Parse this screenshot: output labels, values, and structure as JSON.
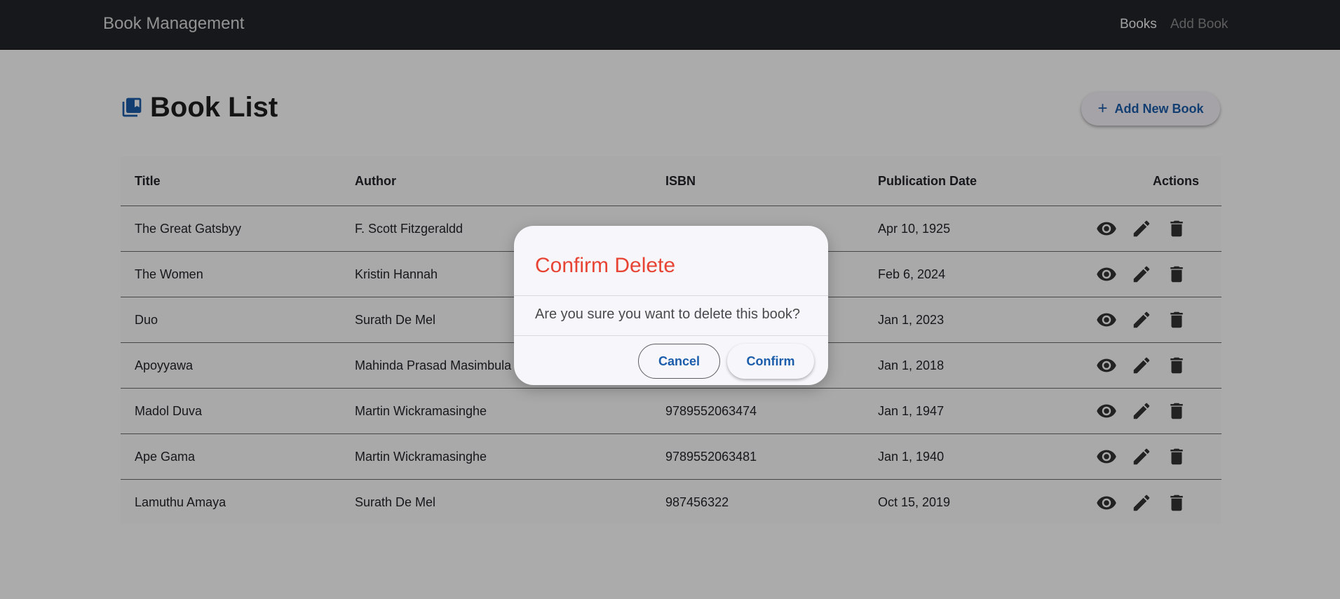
{
  "navbar": {
    "brand": "Book Management",
    "links": [
      "Books",
      "Add Book"
    ]
  },
  "page": {
    "title": "Book List",
    "title_icon": "library-books-icon",
    "add_button_label": "Add New Book",
    "add_button_icon": "plus-icon"
  },
  "table": {
    "headers": [
      "Title",
      "Author",
      "ISBN",
      "Publication Date",
      "Actions"
    ],
    "rows": [
      {
        "title": "The Great Gatsbyy",
        "author": "F. Scott Fitzgeraldd",
        "isbn": "",
        "date": "Apr 10, 1925"
      },
      {
        "title": "The Women",
        "author": "Kristin Hannah",
        "isbn": "",
        "date": "Feb 6, 2024"
      },
      {
        "title": "Duo",
        "author": "Surath De Mel",
        "isbn": "",
        "date": "Jan 1, 2023"
      },
      {
        "title": "Apoyyawa",
        "author": "Mahinda Prasad Masimbula",
        "isbn": "",
        "date": "Jan 1, 2018"
      },
      {
        "title": "Madol Duva",
        "author": "Martin Wickramasinghe",
        "isbn": "9789552063474",
        "date": "Jan 1, 1947"
      },
      {
        "title": "Ape Gama",
        "author": "Martin Wickramasinghe",
        "isbn": "9789552063481",
        "date": "Jan 1, 1940"
      },
      {
        "title": "Lamuthu Amaya",
        "author": "Surath De Mel",
        "isbn": "987456322",
        "date": "Oct 15, 2019"
      }
    ],
    "row_action_icons": [
      "eye-icon",
      "pencil-icon",
      "trash-icon"
    ]
  },
  "dialog": {
    "title": "Confirm Delete",
    "message": "Are you sure you want to delete this book?",
    "cancel_label": "Cancel",
    "confirm_label": "Confirm"
  },
  "colors": {
    "navbar_bg": "#212529",
    "accent": "#1b5dab",
    "danger_title": "#e74434",
    "overlay": "rgba(0,0,0,0.33)"
  }
}
